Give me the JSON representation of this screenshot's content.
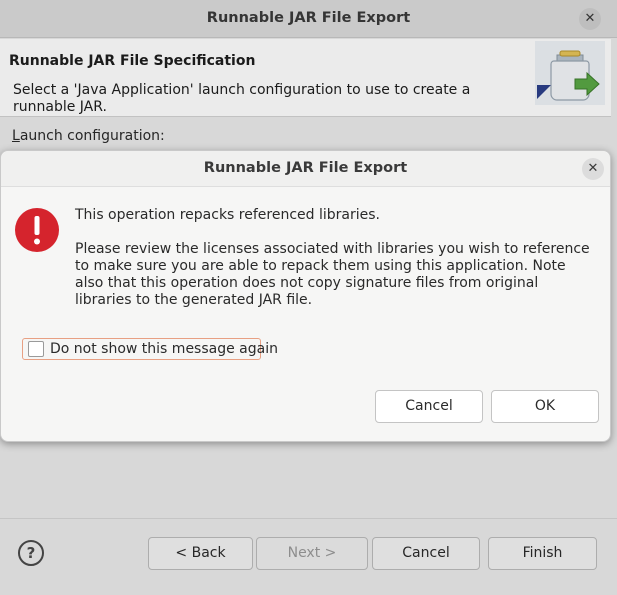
{
  "parent_window": {
    "title": "Runnable JAR File Export",
    "close_glyph": "✕",
    "spec_title": "Runnable JAR File Specification",
    "spec_description": "Select a 'Java Application' launch configuration to use to create a runnable JAR.",
    "launch_label_mnemonic": "L",
    "launch_label_rest": "aunch configuration:",
    "help_glyph": "?",
    "buttons": {
      "back": "< Back",
      "next": "Next >",
      "cancel": "Cancel",
      "finish": "Finish"
    }
  },
  "dialog": {
    "title": "Runnable JAR File Export",
    "close_glyph": "✕",
    "icon": "error-icon",
    "headline": "This operation repacks referenced libraries.",
    "body": "Please review the licenses associated with libraries you wish to reference to make sure you are able to repack them using this application. Note also that this operation does not copy signature files from original libraries to the generated JAR file.",
    "checkbox_label": "Do not show this message again",
    "checkbox_checked": false,
    "buttons": {
      "cancel": "Cancel",
      "ok": "OK"
    }
  },
  "colors": {
    "error_red": "#d5242d",
    "focus_outline": "#e8a083"
  }
}
